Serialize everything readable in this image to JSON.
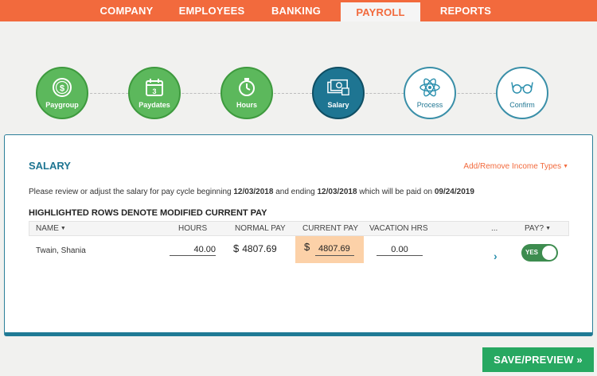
{
  "nav": {
    "items": [
      {
        "label": "COMPANY",
        "active": false
      },
      {
        "label": "EMPLOYEES",
        "active": false
      },
      {
        "label": "BANKING",
        "active": false
      },
      {
        "label": "PAYROLL",
        "active": true
      },
      {
        "label": "REPORTS",
        "active": false
      }
    ]
  },
  "steps": [
    {
      "label": "Paygroup",
      "state": "done",
      "icon": "dollar-coin-icon"
    },
    {
      "label": "Paydates",
      "state": "done",
      "icon": "calendar-icon"
    },
    {
      "label": "Hours",
      "state": "done",
      "icon": "stopwatch-icon"
    },
    {
      "label": "Salary",
      "state": "current",
      "icon": "cash-icon"
    },
    {
      "label": "Process",
      "state": "todo",
      "icon": "atom-icon"
    },
    {
      "label": "Confirm",
      "state": "todo",
      "icon": "glasses-icon"
    }
  ],
  "panel": {
    "title": "SALARY",
    "income_link": "Add/Remove Income Types",
    "desc": {
      "prefix": "Please review or adjust the salary for pay cycle beginning",
      "begin": "12/03/2018",
      "mid": "and ending",
      "end": "12/03/2018",
      "paid": "which will be paid on",
      "paydate": "09/24/2019"
    },
    "highlight_note": "HIGHLIGHTED ROWS DENOTE MODIFIED CURRENT PAY",
    "columns": {
      "name": "NAME",
      "hours": "HOURS",
      "normal_pay": "NORMAL PAY",
      "current_pay": "CURRENT PAY",
      "vacation": "VACATION HRS",
      "more": "...",
      "pay": "PAY?"
    },
    "row": {
      "name": "Twain, Shania",
      "hours": "40.00",
      "currency": "$",
      "normal_pay": "4807.69",
      "current_pay": "4807.69",
      "vacation": "0.00",
      "pay_toggle": "YES"
    }
  },
  "save_button": "SAVE/PREVIEW »",
  "colors": {
    "accent": "#f26a3d",
    "teal": "#1e7592",
    "green": "#27a861",
    "highlight": "#fcd1a8"
  }
}
